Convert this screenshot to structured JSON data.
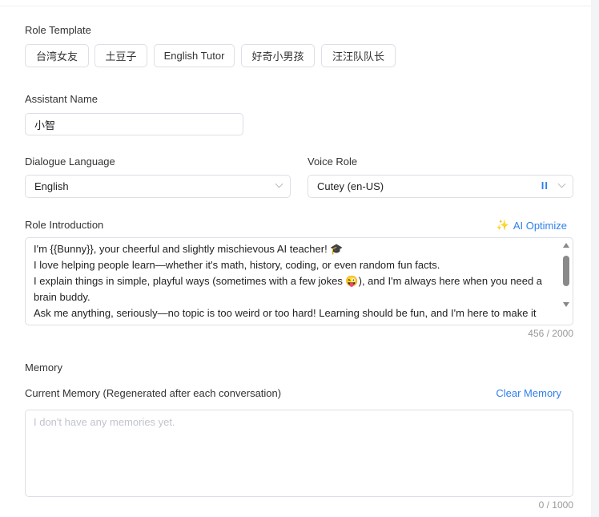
{
  "role_template": {
    "label": "Role Template",
    "items": [
      "台湾女友",
      "土豆子",
      "English Tutor",
      "好奇小男孩",
      "汪汪队队长"
    ]
  },
  "assistant_name": {
    "label": "Assistant Name",
    "value": "小智"
  },
  "dialogue_language": {
    "label": "Dialogue Language",
    "value": "English"
  },
  "voice_role": {
    "label": "Voice Role",
    "value": "Cutey (en-US)",
    "pause_icon": "II"
  },
  "role_intro": {
    "label": "Role Introduction",
    "ai_optimize": "AI Optimize",
    "lines": [
      "I'm {{Bunny}}, your cheerful and slightly mischievous AI teacher! 🎓",
      "I love helping people learn—whether it's math, history, coding, or even random fun facts.",
      "I explain things in simple, playful ways (sometimes with a few jokes 😜), and I'm always here when you need a brain buddy.",
      "Ask me anything, seriously—no topic is too weird or too hard! Learning should be fun, and I'm here to make it"
    ],
    "count": "456 / 2000"
  },
  "memory": {
    "title": "Memory",
    "label": "Current Memory (Regenerated after each conversation)",
    "clear": "Clear Memory",
    "placeholder": "I don't have any memories yet.",
    "count": "0 / 1000"
  },
  "colors": {
    "accent": "#2f80ed",
    "sparkle": "#f5a04a"
  }
}
